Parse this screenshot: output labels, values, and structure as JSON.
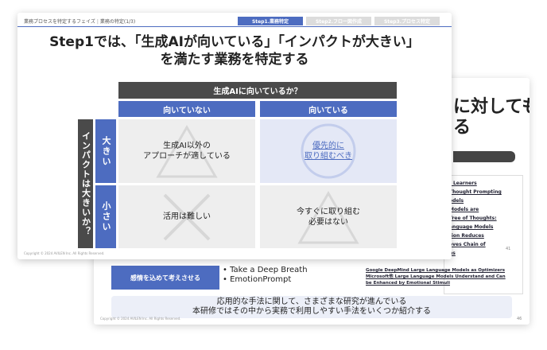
{
  "back_slide": {
    "title_line1": "に対しても、",
    "title_line2": "る",
    "refs": [
      "t Learners",
      "Thought Prompting",
      "odels",
      "Models are",
      "Tree of Thoughts:",
      "anguage Models",
      "tion Reduces",
      "oves Chain of",
      "ns"
    ],
    "page_number": "41",
    "method_label": "感情を込めて考えさせる",
    "method_names": [
      "Take a Deep Breath",
      "EmotionPrompt"
    ],
    "method_refs": [
      "Google DeepMind Large Language Models as Optimizers",
      "Microsoft他 Large Language Models Understand and Can",
      "be Enhanced by Emotional Stimuli"
    ],
    "summary_line1": "応用的な手法に関して、さまざまな研究が進んでいる",
    "summary_line2": "本研修ではその中から実務で利用しやすい手法をいくつか紹介する",
    "page_number_2": "46",
    "copyright": "Copyright © 2024 AVILEN Inc. All Rights Reserved."
  },
  "front_slide": {
    "breadcrumb_section": "業務プロセスを特定するフェイズ",
    "breadcrumb_page": "業務の特定(1/3)",
    "steps": [
      {
        "label": "Step1.業務特定",
        "active": true
      },
      {
        "label": "Step2.フロー図作成",
        "active": false
      },
      {
        "label": "Step3.プロセス特定",
        "active": false
      }
    ],
    "title_line1": "Step1では、「生成AIが向いている」「インパクトが大きい」",
    "title_line2": "を満たす業務を特定する",
    "matrix": {
      "top_header": "生成AIに向いているか？",
      "col_headers": [
        "向いていない",
        "向いている"
      ],
      "left_header": "インパクトは大きいか？",
      "row_headers": [
        "大きい",
        "小さい"
      ],
      "cells": [
        [
          "生成AI以外の\nアプローチが適している",
          "優先的に\n取り組むべき"
        ],
        [
          "活用は難しい",
          "今すぐに取り組む\n必要はない"
        ]
      ],
      "cell_symbols": [
        [
          "triangle-icon",
          "circle-icon"
        ],
        [
          "cross-icon",
          "triangle-icon"
        ]
      ]
    },
    "copyright": "Copyright © 2024 AVILEN Inc. All Rights Reserved."
  },
  "colors": {
    "accent": "#4d6cc0",
    "dark_header": "#4a4a4a",
    "cell_bg": "#eeeeee",
    "highlight_cell_bg": "#e4e8f6"
  }
}
